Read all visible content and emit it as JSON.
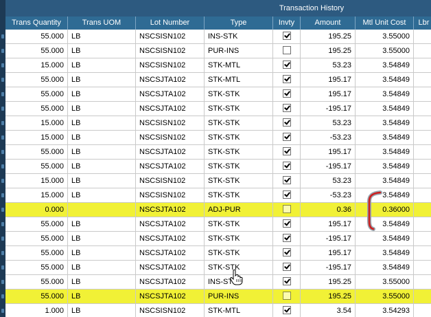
{
  "section_title": "Transaction History",
  "columns": [
    "Trans Quantity",
    "Trans UOM",
    "Lot Number",
    "Type",
    "Invty",
    "Amount",
    "Mtl Unit Cost",
    "Lbr"
  ],
  "rows": [
    {
      "qty": "55.000",
      "uom": "LB",
      "lot": "NSCSISN102",
      "type": "INS-STK",
      "invty": true,
      "amount": "195.25",
      "cost": "3.55000",
      "lbr": "",
      "highlight": false
    },
    {
      "qty": "55.000",
      "uom": "LB",
      "lot": "NSCSISN102",
      "type": "PUR-INS",
      "invty": false,
      "amount": "195.25",
      "cost": "3.55000",
      "lbr": "",
      "highlight": false
    },
    {
      "qty": "15.000",
      "uom": "LB",
      "lot": "NSCSISN102",
      "type": "STK-MTL",
      "invty": true,
      "amount": "53.23",
      "cost": "3.54849",
      "lbr": "",
      "highlight": false
    },
    {
      "qty": "55.000",
      "uom": "LB",
      "lot": "NSCSJTA102",
      "type": "STK-MTL",
      "invty": true,
      "amount": "195.17",
      "cost": "3.54849",
      "lbr": "",
      "highlight": false
    },
    {
      "qty": "55.000",
      "uom": "LB",
      "lot": "NSCSJTA102",
      "type": "STK-STK",
      "invty": true,
      "amount": "195.17",
      "cost": "3.54849",
      "lbr": "",
      "highlight": false
    },
    {
      "qty": "55.000",
      "uom": "LB",
      "lot": "NSCSJTA102",
      "type": "STK-STK",
      "invty": true,
      "amount": "-195.17",
      "cost": "3.54849",
      "lbr": "",
      "highlight": false
    },
    {
      "qty": "15.000",
      "uom": "LB",
      "lot": "NSCSISN102",
      "type": "STK-STK",
      "invty": true,
      "amount": "53.23",
      "cost": "3.54849",
      "lbr": "",
      "highlight": false
    },
    {
      "qty": "15.000",
      "uom": "LB",
      "lot": "NSCSISN102",
      "type": "STK-STK",
      "invty": true,
      "amount": "-53.23",
      "cost": "3.54849",
      "lbr": "",
      "highlight": false
    },
    {
      "qty": "55.000",
      "uom": "LB",
      "lot": "NSCSJTA102",
      "type": "STK-STK",
      "invty": true,
      "amount": "195.17",
      "cost": "3.54849",
      "lbr": "",
      "highlight": false
    },
    {
      "qty": "55.000",
      "uom": "LB",
      "lot": "NSCSJTA102",
      "type": "STK-STK",
      "invty": true,
      "amount": "-195.17",
      "cost": "3.54849",
      "lbr": "",
      "highlight": false
    },
    {
      "qty": "15.000",
      "uom": "LB",
      "lot": "NSCSISN102",
      "type": "STK-STK",
      "invty": true,
      "amount": "53.23",
      "cost": "3.54849",
      "lbr": "",
      "highlight": false
    },
    {
      "qty": "15.000",
      "uom": "LB",
      "lot": "NSCSISN102",
      "type": "STK-STK",
      "invty": true,
      "amount": "-53.23",
      "cost": "3.54849",
      "lbr": "",
      "highlight": false
    },
    {
      "qty": "0.000",
      "uom": "",
      "lot": "NSCSJTA102",
      "type": "ADJ-PUR",
      "invty": false,
      "amount": "0.36",
      "cost": "0.36000",
      "lbr": "",
      "highlight": true
    },
    {
      "qty": "55.000",
      "uom": "LB",
      "lot": "NSCSJTA102",
      "type": "STK-STK",
      "invty": true,
      "amount": "195.17",
      "cost": "3.54849",
      "lbr": "",
      "highlight": false
    },
    {
      "qty": "55.000",
      "uom": "LB",
      "lot": "NSCSJTA102",
      "type": "STK-STK",
      "invty": true,
      "amount": "-195.17",
      "cost": "3.54849",
      "lbr": "",
      "highlight": false
    },
    {
      "qty": "55.000",
      "uom": "LB",
      "lot": "NSCSJTA102",
      "type": "STK-STK",
      "invty": true,
      "amount": "195.17",
      "cost": "3.54849",
      "lbr": "",
      "highlight": false
    },
    {
      "qty": "55.000",
      "uom": "LB",
      "lot": "NSCSJTA102",
      "type": "STK-STK",
      "invty": true,
      "amount": "-195.17",
      "cost": "3.54849",
      "lbr": "",
      "highlight": false
    },
    {
      "qty": "55.000",
      "uom": "LB",
      "lot": "NSCSJTA102",
      "type": "INS-STK",
      "invty": true,
      "amount": "195.25",
      "cost": "3.55000",
      "lbr": "",
      "highlight": false
    },
    {
      "qty": "55.000",
      "uom": "LB",
      "lot": "NSCSJTA102",
      "type": "PUR-INS",
      "invty": false,
      "amount": "195.25",
      "cost": "3.55000",
      "lbr": "",
      "highlight": true
    },
    {
      "qty": "1.000",
      "uom": "LB",
      "lot": "NSCSISN102",
      "type": "STK-MTL",
      "invty": true,
      "amount": "3.54",
      "cost": "3.54293",
      "lbr": "",
      "highlight": false
    }
  ],
  "colors": {
    "header_bg": "#2f6b94",
    "title_bar_bg": "#2d5a80",
    "highlight": "#f1f136",
    "annotation": "#cc1f1f"
  },
  "annotations": {
    "bracket": "red-bracket-annotation",
    "cursor": "hand-pointer-cursor-icon"
  }
}
